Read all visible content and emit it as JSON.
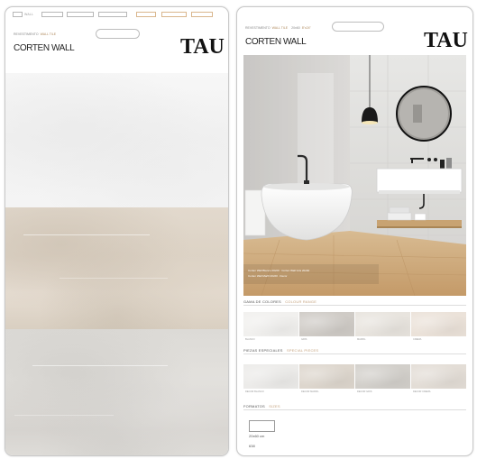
{
  "left": {
    "checkboxes": [
      {
        "label": "WALL",
        "tone": "grey"
      },
      {
        "label": "",
        "tone": "grey"
      },
      {
        "label": "",
        "tone": "grey"
      },
      {
        "label": "",
        "tone": "grey"
      },
      {
        "label": "",
        "tone": "tan"
      },
      {
        "label": "",
        "tone": "tan"
      },
      {
        "label": "",
        "tone": "tan"
      }
    ],
    "line_label": "REVESTIMENTO",
    "line_label_highlight": "WALL TILE",
    "collection": "CORTEN WALL",
    "logo": "TAU",
    "tiles": [
      {
        "name": "white",
        "color": "#f3f3f3"
      },
      {
        "name": "beige",
        "color": "#dfd6ca"
      },
      {
        "name": "grey",
        "color": "#dddbd7"
      }
    ]
  },
  "right": {
    "line_label": "REVESTIMENTO",
    "line_label_highlight": "WALL TILE",
    "line_label_2": "20x60",
    "line_label_2_highlight": "8\"x24\"",
    "collection": "CORTEN WALL",
    "logo": "TAU",
    "scene": {
      "caption_line1": "Corten Wall Blanco 20x60 · Corten Wall Gris 20x60",
      "caption_line2": "Corten Wall Marfil 20x60 · Decor"
    },
    "colors_title": "GAMA DE COLORES",
    "colors_title_sub": "COLOUR RANGE",
    "colors": [
      {
        "name": "BLANCO",
        "color": "#f1f0ee"
      },
      {
        "name": "GRIS",
        "color": "#cfcbc6"
      },
      {
        "name": "MARFIL",
        "color": "#e8e4de"
      },
      {
        "name": "CREMA",
        "color": "#ebe2d9"
      }
    ],
    "pieces_title": "PIEZAS ESPECIALES",
    "pieces_title_sub": "SPECIAL PIECES",
    "pieces": [
      {
        "name": "DECOR BLANCO",
        "color": "#ecebe9"
      },
      {
        "name": "DECOR MARFIL",
        "color": "#ddd6cd"
      },
      {
        "name": "DECOR GRIS",
        "color": "#d2cfca"
      },
      {
        "name": "DECOR CREMA",
        "color": "#e3ddd6"
      }
    ],
    "formats_title": "FORMATOS",
    "formats_title_sub": "SIZES",
    "format_size": "20x60 cm",
    "format_code": "638"
  }
}
